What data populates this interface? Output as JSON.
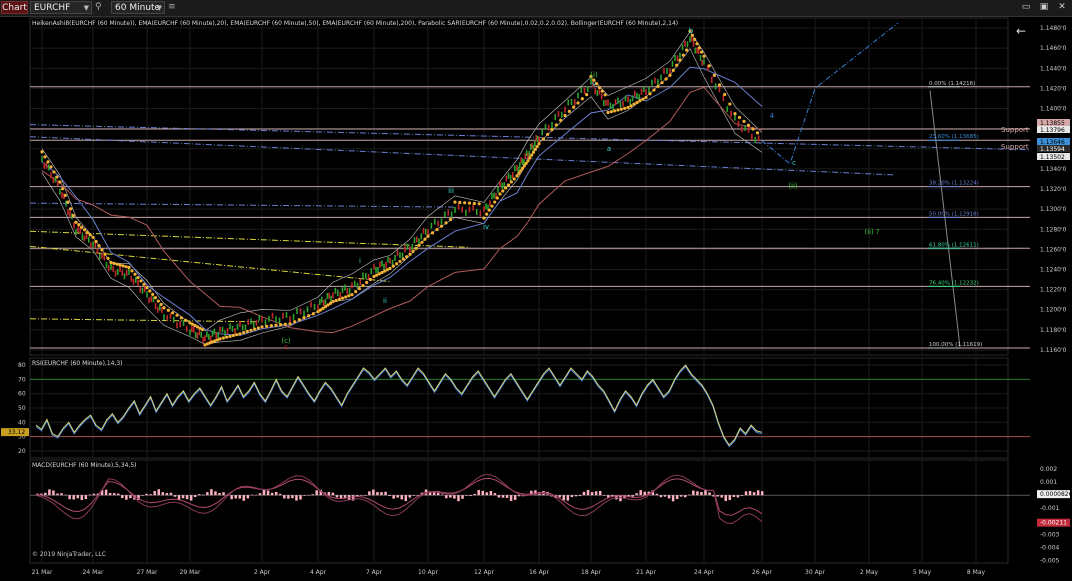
{
  "toolbar": {
    "tab": "Chart",
    "instrument": "EURCHF",
    "period": "60 Minute"
  },
  "panels": {
    "price_title": "HeikenAshi8(EURCHF (60 Minute)), EMA(EURCHF (60 Minute),20), EMA(EURCHF (60 Minute),50), EMA(EURCHF (60 Minute),200), Parabolic SAR(EURCHF (60 Minute),0.02,0.2,0.02), Bollinger(EURCHF (60 Minute),2,14)",
    "rsi_title": "RSI(EURCHF (60 Minute),14,3)",
    "macd_title": "MACD(EURCHF (60 Minute),5,34,5)",
    "copyright": "© 2019 NinjaTrader, LLC"
  },
  "chart_data": [
    {
      "type": "line",
      "panel": "price",
      "x_labels": [
        "21 Mar",
        "24 Mar",
        "27 Mar",
        "29 Mar",
        "2 Apr",
        "4 Apr",
        "7 Apr",
        "10 Apr",
        "12 Apr",
        "16 Apr",
        "18 Apr",
        "21 Apr",
        "24 Apr",
        "26 Apr",
        "30 Apr",
        "2 May",
        "5 May",
        "8 May"
      ],
      "y_ticks": [
        "1.1480'0",
        "1.1460'0",
        "1.1440'0",
        "1.1420'0",
        "1.1400'0",
        "1.1380'0",
        "1.1360'0",
        "1.1340'0",
        "1.1320'0",
        "1.1300'0",
        "1.1280'0",
        "1.1260'0",
        "1.1240'0",
        "1.1220'0",
        "1.1200'0",
        "1.1180'0",
        "1.1160'0"
      ],
      "ylim": [
        1.1155,
        1.149
      ],
      "price_path": [
        [
          "21 Mar",
          1.135
        ],
        [
          "22 Mar",
          1.132
        ],
        [
          "23 Mar",
          1.128
        ],
        [
          "24 Mar",
          1.1265
        ],
        [
          "25 Mar",
          1.124
        ],
        [
          "26 Mar",
          1.1235
        ],
        [
          "27 Mar",
          1.1215
        ],
        [
          "28 Mar",
          1.1195
        ],
        [
          "29 Mar",
          1.118
        ],
        [
          "30 Mar",
          1.1172
        ],
        [
          "31 Mar",
          1.1178
        ],
        [
          "1 Apr",
          1.1183
        ],
        [
          "2 Apr",
          1.119
        ],
        [
          "3 Apr",
          1.1193
        ],
        [
          "4 Apr",
          1.1205
        ],
        [
          "5 Apr",
          1.1215
        ],
        [
          "6 Apr",
          1.1222
        ],
        [
          "7 Apr",
          1.124
        ],
        [
          "8 Apr",
          1.1248
        ],
        [
          "9 Apr",
          1.1262
        ],
        [
          "10 Apr",
          1.128
        ],
        [
          "11 Apr",
          1.13
        ],
        [
          "12 Apr",
          1.1298
        ],
        [
          "13 Apr",
          1.1322
        ],
        [
          "14 Apr",
          1.134
        ],
        [
          "15 Apr",
          1.1355
        ],
        [
          "16 Apr",
          1.1372
        ],
        [
          "17 Apr",
          1.14
        ],
        [
          "18 Apr",
          1.1425
        ],
        [
          "19 Apr",
          1.1403
        ],
        [
          "20 Apr",
          1.1408
        ],
        [
          "21 Apr",
          1.1418
        ],
        [
          "22 Apr",
          1.144
        ],
        [
          "23 Apr",
          1.147
        ],
        [
          "24 Apr",
          1.1445
        ],
        [
          "25 Apr",
          1.1388
        ],
        [
          "26 Apr",
          1.1365
        ]
      ],
      "horizontal_levels": [
        1.14216,
        1.13796,
        1.13685,
        1.13224,
        1.12918,
        1.12611,
        1.12232,
        1.11619
      ],
      "fib_labels": [
        "0.00% (1.14216)",
        "23.60% (1.13685)",
        "38.20% (1.13224)",
        "50.00% (1.12918)",
        "61.80% (1.12611)",
        "76.40% (1.12232)",
        "100.00% (1.11619)"
      ],
      "support_labels": [
        "Support",
        "Support"
      ],
      "price_boxes": [
        "1.13855",
        "1.13796",
        "1.13646",
        "1.13594",
        "1.13502"
      ],
      "wave_labels": [
        "b",
        "(i)",
        "v",
        "a",
        "4",
        "c",
        "(ii)",
        "(ii) ?",
        "iii",
        "iv",
        "i",
        "ii",
        "(c)",
        "c"
      ],
      "projection": [
        [
          "26 Apr",
          1.1368
        ],
        [
          "27 Apr",
          1.1345
        ],
        [
          "30 Apr",
          1.142
        ],
        [
          "3 May",
          1.1485
        ]
      ]
    },
    {
      "type": "line",
      "panel": "rsi",
      "y_ticks": [
        "80",
        "70",
        "60",
        "50",
        "40",
        "30",
        "20"
      ],
      "ylim": [
        15,
        85
      ],
      "last_value": "33.12",
      "levels": [
        70,
        30
      ],
      "values": [
        38,
        35,
        42,
        32,
        30,
        36,
        40,
        33,
        38,
        42,
        45,
        38,
        35,
        42,
        46,
        40,
        44,
        50,
        55,
        46,
        52,
        58,
        48,
        54,
        60,
        52,
        58,
        62,
        55,
        60,
        64,
        58,
        52,
        58,
        65,
        55,
        60,
        66,
        58,
        62,
        68,
        60,
        55,
        62,
        70,
        62,
        58,
        65,
        72,
        66,
        60,
        55,
        62,
        68,
        64,
        58,
        52,
        60,
        66,
        72,
        78,
        75,
        70,
        74,
        78,
        72,
        76,
        70,
        66,
        72,
        78,
        74,
        68,
        62,
        68,
        74,
        70,
        64,
        60,
        66,
        72,
        76,
        70,
        64,
        58,
        64,
        70,
        74,
        68,
        62,
        56,
        62,
        68,
        74,
        78,
        72,
        66,
        72,
        78,
        74,
        70,
        76,
        72,
        66,
        62,
        55,
        48,
        56,
        62,
        58,
        52,
        60,
        66,
        70,
        64,
        58,
        62,
        70,
        76,
        80,
        74,
        70,
        66,
        60,
        52,
        40,
        30,
        24,
        28,
        36,
        32,
        38,
        34,
        33
      ]
    },
    {
      "type": "bar",
      "panel": "macd",
      "y_ticks": [
        "0.002",
        "0.001",
        "0",
        "-0.001",
        "-0.002",
        "-0.003",
        "-0.004",
        "-0.005"
      ],
      "ylim": [
        -0.0052,
        0.0027
      ],
      "last_values": [
        "0.0000826",
        "-0.00211"
      ]
    }
  ],
  "colors": {
    "background": "#000000",
    "grid": "#1c1c1c",
    "level_line": "#c8a8a8",
    "sar_dots": "#f2b134",
    "ema": "#6a7fd0",
    "ema200": "#b05a5a",
    "bollinger": "#c8c8c8",
    "projection": "#3a7fd8",
    "wave_green": "#38c838",
    "wave_cyan": "#3ad6d6",
    "rsi_line": "#d7d77a",
    "macd_hist": "#ffb3c1"
  }
}
